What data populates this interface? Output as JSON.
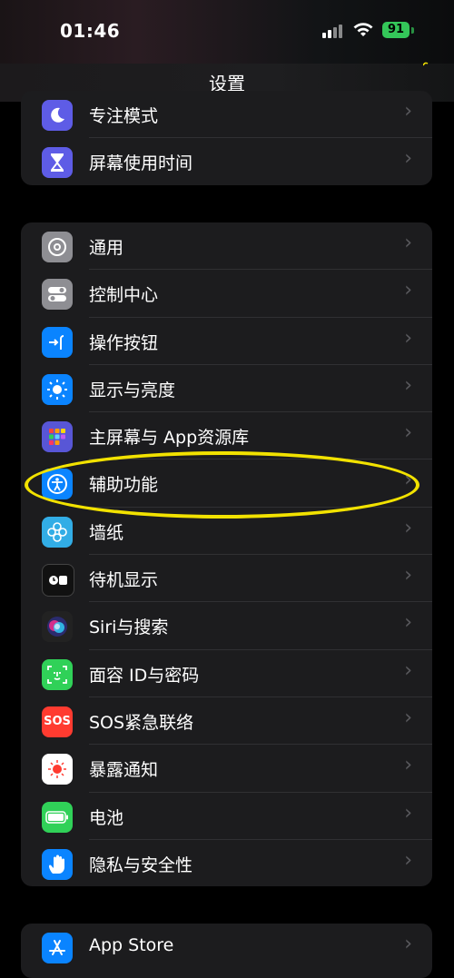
{
  "status": {
    "time": "01:46",
    "battery": "91"
  },
  "nav": {
    "title": "设置"
  },
  "group1": [
    {
      "label": "专注模式",
      "icon": "moon-icon",
      "color": "#5e5ce6"
    },
    {
      "label": "屏幕使用时间",
      "icon": "hourglass-icon",
      "color": "#5e5ce6"
    }
  ],
  "group2": [
    {
      "label": "通用",
      "icon": "gear-icon",
      "color": "#8e8e93"
    },
    {
      "label": "控制中心",
      "icon": "toggles-icon",
      "color": "#8e8e93"
    },
    {
      "label": "操作按钮",
      "icon": "action-button-icon",
      "color": "#0a84ff"
    },
    {
      "label": "显示与亮度",
      "icon": "sun-icon",
      "color": "#0a84ff"
    },
    {
      "label": "主屏幕与 App资源库",
      "icon": "app-grid-icon",
      "color": "#5856d6"
    },
    {
      "label": "辅助功能",
      "icon": "accessibility-icon",
      "color": "#0a84ff"
    },
    {
      "label": "墙纸",
      "icon": "flower-icon",
      "color": "#32ade6"
    },
    {
      "label": "待机显示",
      "icon": "standby-icon",
      "color": "#111111"
    },
    {
      "label": "Siri与搜索",
      "icon": "siri-icon",
      "color": "#222222"
    },
    {
      "label": "面容 ID与密码",
      "icon": "face-id-icon",
      "color": "#30d158"
    },
    {
      "label": "SOS紧急联络",
      "icon": "sos-icon",
      "color": "#ff3b30",
      "text": "SOS"
    },
    {
      "label": "暴露通知",
      "icon": "exposure-icon",
      "color": "#ffffff"
    },
    {
      "label": "电池",
      "icon": "battery-icon",
      "color": "#30d158"
    },
    {
      "label": "隐私与安全性",
      "icon": "hand-icon",
      "color": "#0a84ff"
    }
  ],
  "group3": [
    {
      "label": "App Store",
      "icon": "app-store-icon",
      "color": "#0a84ff"
    }
  ],
  "highlight": {
    "color": "#f2e200"
  }
}
